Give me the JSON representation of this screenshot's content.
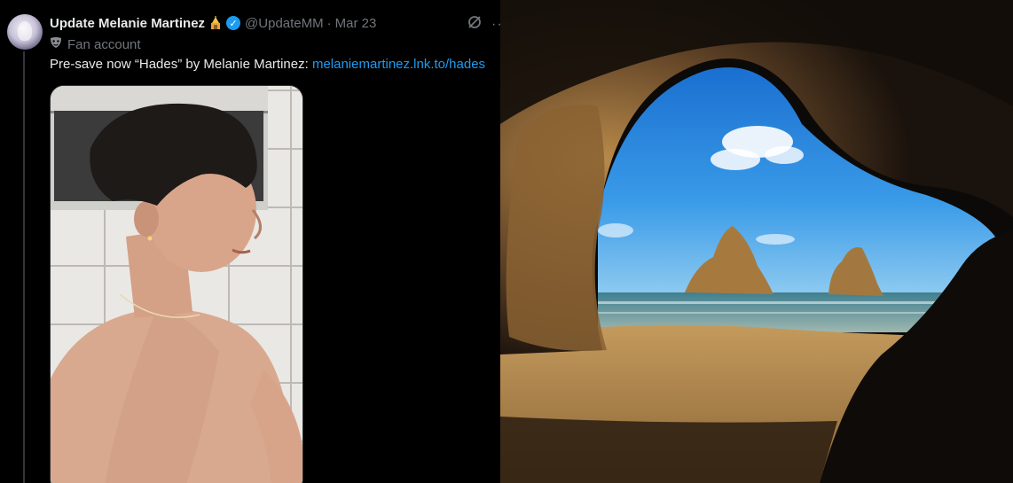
{
  "tweet": {
    "display_name": "Update Melanie Martinez",
    "name_emoji": "🕍",
    "verified": true,
    "handle": "@UpdateMM",
    "separator": "·",
    "date": "Mar 23",
    "account_label": "Fan account",
    "text_prefix": "Pre-save now “Hades” by Melanie Martinez: ",
    "link_text": "melaniemartinez.lnk.to/hades",
    "more_label": "···"
  },
  "icons": {
    "avatar": "avatar",
    "verified": "verified-badge-icon",
    "grok": "grok-icon",
    "more": "more-icon",
    "mask": "theater-mask-icon"
  },
  "colors": {
    "background": "#000000",
    "primary_text": "#e7e9ea",
    "secondary_text": "#71767b",
    "link": "#1d9bf0",
    "verified": "#1d9bf0"
  }
}
